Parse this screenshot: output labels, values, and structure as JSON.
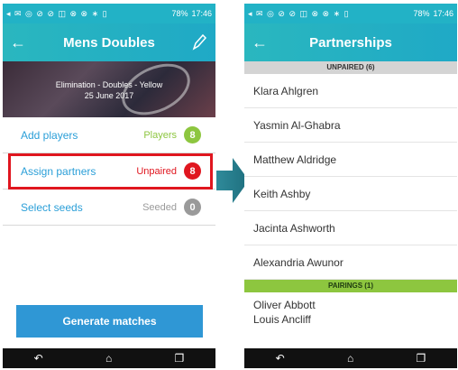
{
  "status_bar": {
    "icons_text": "◂ ✉ ◎ ⊘ ⊘ ◫ ⊗ ⊗  ∗ ▯",
    "battery": "78%",
    "time": "17:46"
  },
  "left_screen": {
    "title": "Mens Doubles",
    "banner": {
      "line1": "Elimination - Doubles - Yellow",
      "line2": "25 June 2017"
    },
    "rows": [
      {
        "label": "Add players",
        "status": "Players",
        "count": "8",
        "status_color": "#8dc63f",
        "badge_color": "#8dc63f"
      },
      {
        "label": "Assign partners",
        "status": "Unpaired",
        "count": "8",
        "status_color": "#e0161f",
        "badge_color": "#e0161f"
      },
      {
        "label": "Select seeds",
        "status": "Seeded",
        "count": "0",
        "status_color": "#9a9a9a",
        "badge_color": "#9a9a9a"
      }
    ],
    "generate_label": "Generate matches"
  },
  "right_screen": {
    "title": "Partnerships",
    "unpaired_header": "UNPAIRED (6)",
    "unpaired": [
      "Klara Ahlgren",
      "Yasmin Al-Ghabra",
      "Matthew Aldridge",
      "Keith Ashby",
      "Jacinta Ashworth",
      "Alexandria Awunor"
    ],
    "pairings_header": "PAIRINGS (1)",
    "pairings": [
      {
        "player1": "Oliver Abbott",
        "player2": "Louis Ancliff"
      }
    ]
  },
  "nav_icons": [
    "back-icon",
    "home-icon",
    "recents-icon"
  ],
  "colors": {
    "accent": "#22b2c6",
    "highlight": "#e0161f",
    "button": "#2f97d5"
  }
}
